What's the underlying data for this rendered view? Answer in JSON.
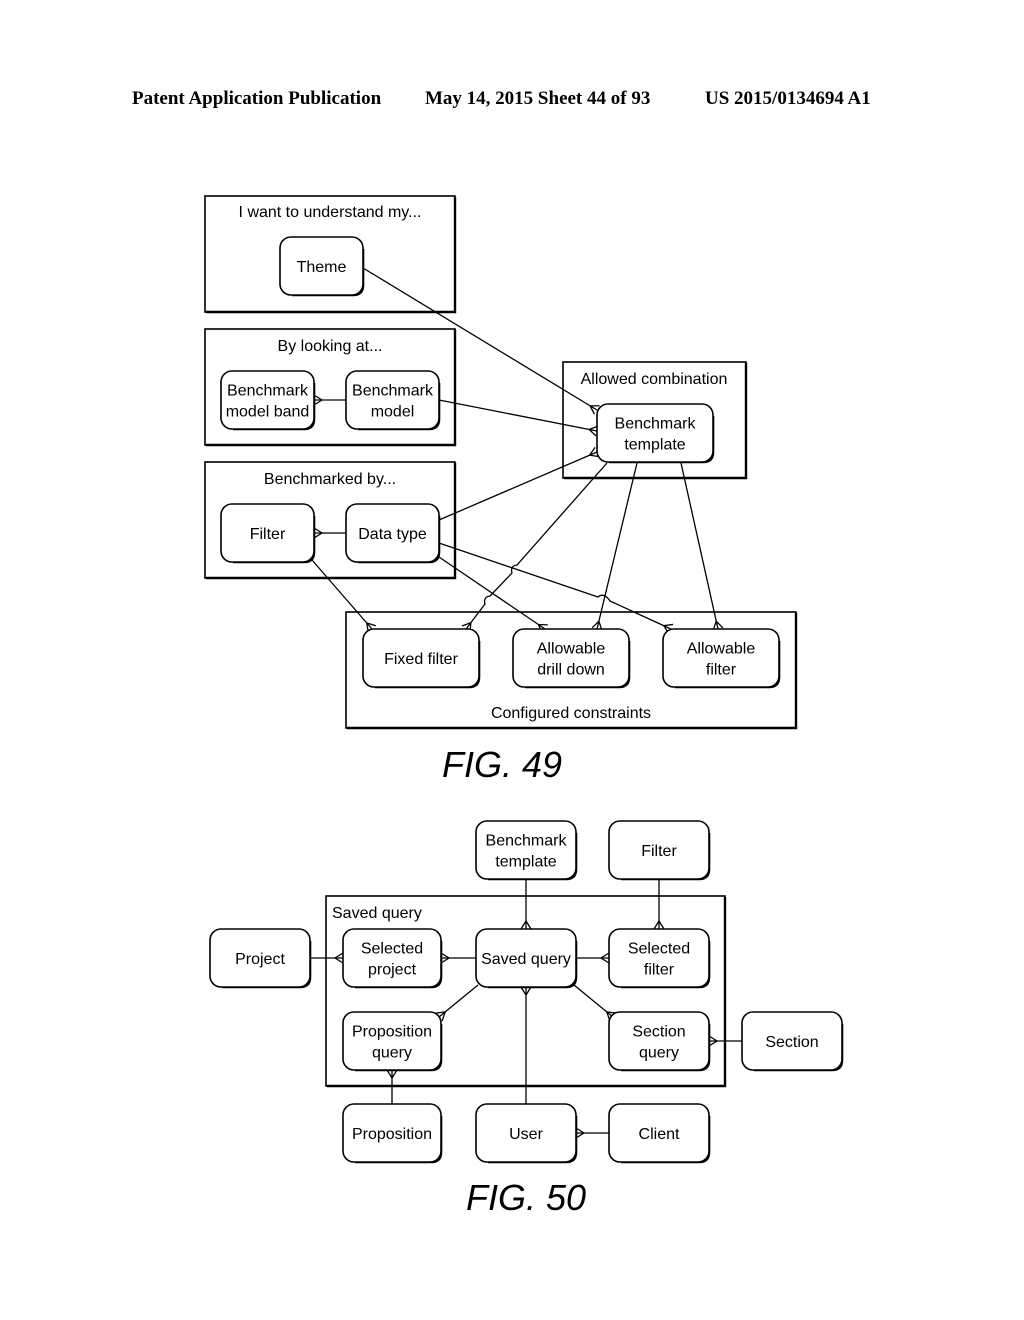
{
  "header": {
    "left": "Patent Application Publication",
    "middle": "May 14, 2015  Sheet 44 of 93",
    "right": "US 2015/0134694 A1"
  },
  "fig49": {
    "caption": "FIG. 49",
    "groups": {
      "understand": "I want to understand my...",
      "looking": "By looking at...",
      "benchmarked": "Benchmarked by...",
      "allowed": "Allowed combination",
      "constraints": "Configured constraints"
    },
    "nodes": {
      "theme": [
        "Theme"
      ],
      "bm_model_band": [
        "Benchmark",
        "model band"
      ],
      "bm_model": [
        "Benchmark",
        "model"
      ],
      "filter": [
        "Filter"
      ],
      "data_type": [
        "Data type"
      ],
      "bm_template": [
        "Benchmark",
        "template"
      ],
      "fixed_filter": [
        "Fixed filter"
      ],
      "drill_down": [
        "Allowable",
        "drill down"
      ],
      "allow_filter": [
        "Allowable",
        "filter"
      ]
    }
  },
  "fig50": {
    "caption": "FIG. 50",
    "groups": {
      "saved_query": "Saved query"
    },
    "nodes": {
      "bm_template": [
        "Benchmark",
        "template"
      ],
      "filter": [
        "Filter"
      ],
      "project": [
        "Project"
      ],
      "selected_project": [
        "Selected",
        "project"
      ],
      "saved_query": [
        "Saved query"
      ],
      "selected_filter": [
        "Selected",
        "filter"
      ],
      "proposition_query": [
        "Proposition",
        "query"
      ],
      "section_query": [
        "Section",
        "query"
      ],
      "section": [
        "Section"
      ],
      "proposition": [
        "Proposition"
      ],
      "user": [
        "User"
      ],
      "client": [
        "Client"
      ]
    }
  }
}
